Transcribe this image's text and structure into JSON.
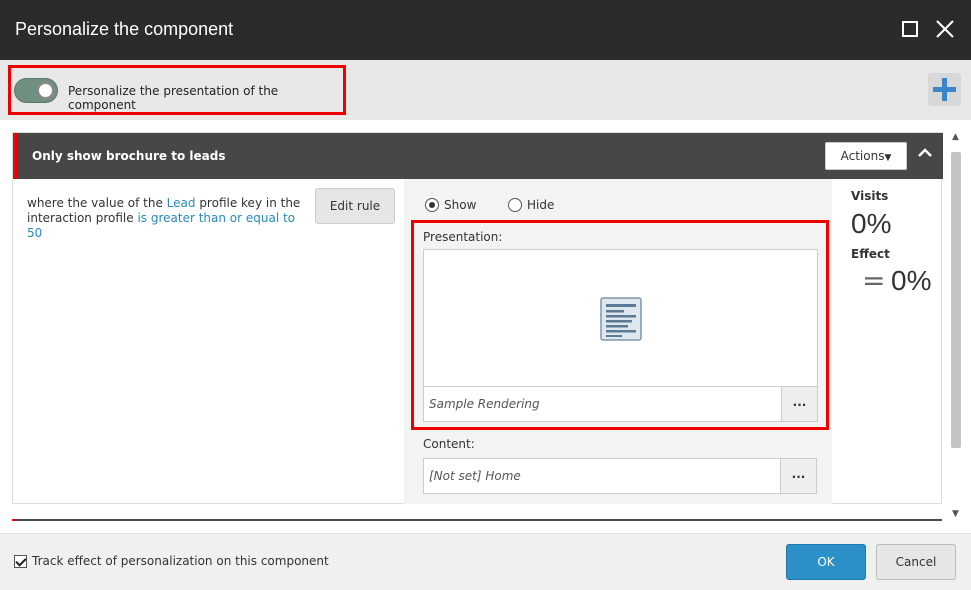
{
  "dialog": {
    "title": "Personalize the component",
    "maximize_icon": "maximize-icon",
    "close_icon": "close-icon"
  },
  "toolbar": {
    "toggle_label": "Personalize the presentation of the component",
    "toggle_on": true,
    "add_icon": "plus-icon",
    "accent_color": "#3a86c8"
  },
  "rule": {
    "title": "Only show brochure to leads",
    "actions_label": "Actions",
    "condition": {
      "prefix": "where the value of the ",
      "key_link": "Lead",
      "middle": " profile key in the interaction profile ",
      "operator_link": "is greater than or equal to 50"
    },
    "edit_rule_label": "Edit rule",
    "show_label": "Show",
    "hide_label": "Hide",
    "selected": "Show",
    "presentation_label": "Presentation:",
    "presentation_value": "Sample Rendering",
    "content_label": "Content:",
    "content_value": "[Not set] Home",
    "more_label": "..."
  },
  "stats": {
    "visits_label": "Visits",
    "visits_value": "0%",
    "effect_label": "Effect",
    "effect_symbol": "=",
    "effect_value": "0%"
  },
  "footer": {
    "track_label": "Track effect of personalization on this component",
    "track_checked": true,
    "ok_label": "OK",
    "cancel_label": "Cancel",
    "primary_color": "#2b90c8"
  }
}
